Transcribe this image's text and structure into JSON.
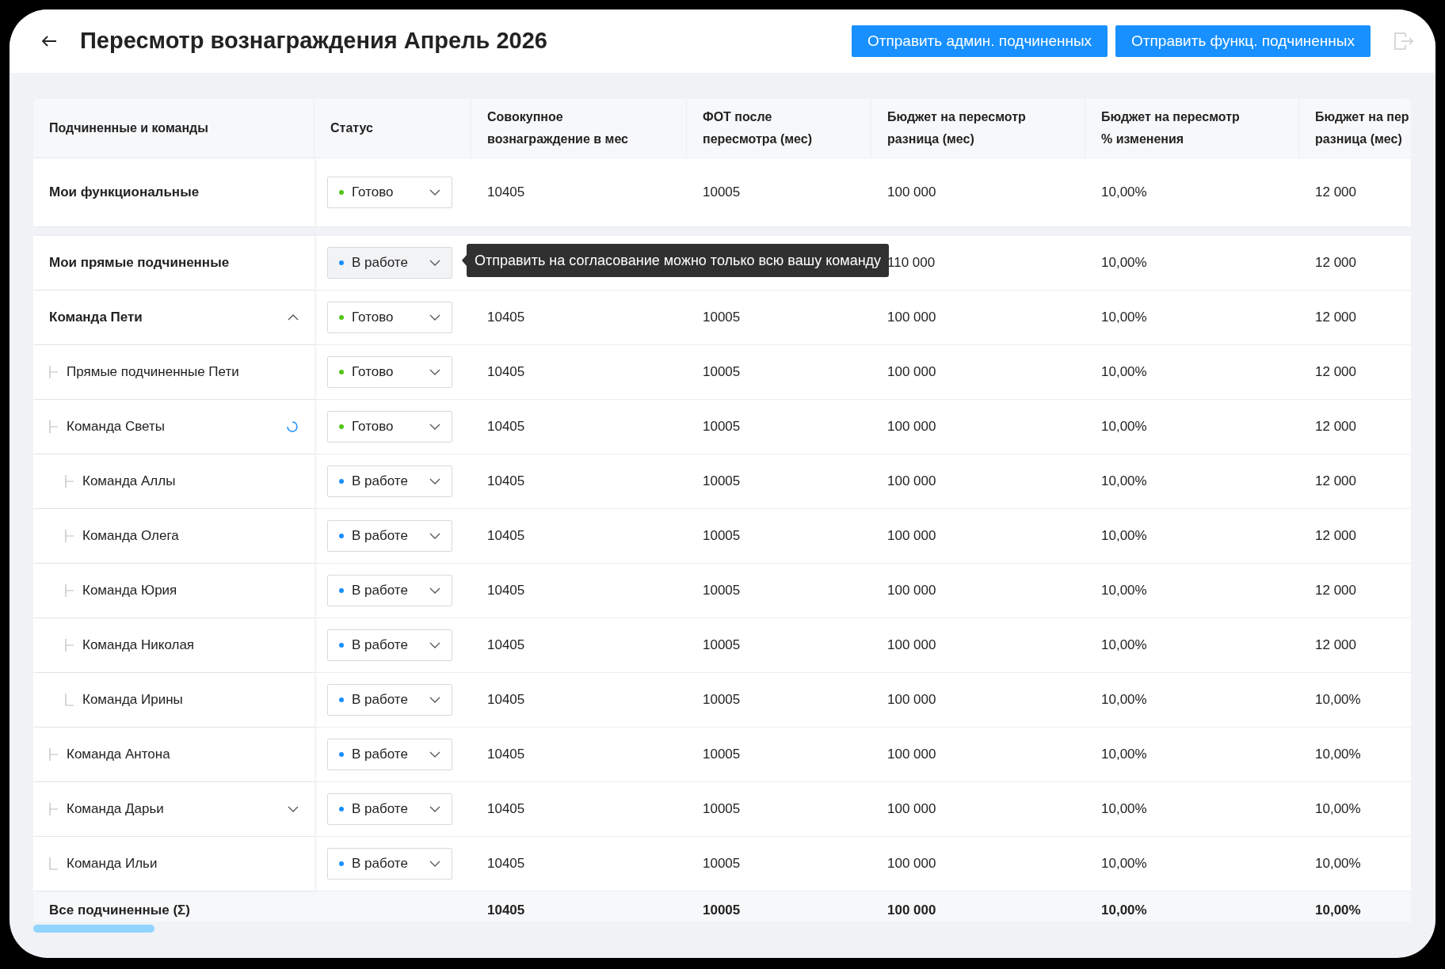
{
  "header": {
    "title": "Пересмотр вознаграждения Апрель 2026",
    "buttons": [
      "Отправить админ. подчиненных",
      "Отправить функц. подчиненных"
    ]
  },
  "table": {
    "columns": [
      {
        "lines": [
          "Подчиненные и команды"
        ]
      },
      {
        "lines": [
          "Статус"
        ]
      },
      {
        "lines": [
          "Совокупное",
          "вознаграждение в мес"
        ]
      },
      {
        "lines": [
          "ФОТ после",
          "пересмотра (мес)"
        ]
      },
      {
        "lines": [
          "Бюджет на пересмотр",
          "разница (мес)"
        ]
      },
      {
        "lines": [
          "Бюджет на пересмотр",
          "% изменения"
        ]
      },
      {
        "lines": [
          "Бюджет на пер",
          "разница (мес)"
        ]
      }
    ],
    "groups": [
      {
        "rows": [
          {
            "name": "Мои функциональные",
            "bold": true,
            "status": {
              "label": "Готово",
              "kind": "done",
              "disabled": false
            },
            "cells": [
              "10405",
              "10005",
              "100 000",
              "10,00%",
              "12 000"
            ]
          }
        ]
      },
      {
        "rows": [
          {
            "name": "Мои прямые подчиненные",
            "bold": true,
            "status": {
              "label": "В работе",
              "kind": "in_progress",
              "disabled": true
            },
            "tooltip": "Отправить на согласование можно только всю вашу команду",
            "cells": [
              null,
              null,
              "110 000",
              "10,00%",
              "12 000"
            ]
          },
          {
            "name": "Команда Пети",
            "bold": true,
            "expanded": true,
            "status": {
              "label": "Готово",
              "kind": "done",
              "disabled": false
            },
            "cells": [
              "10405",
              "10005",
              "100 000",
              "10,00%",
              "12 000"
            ],
            "children": [
              {
                "name": "Прямые подчиненные Пети",
                "status": {
                  "label": "Готово",
                  "kind": "done",
                  "disabled": false
                },
                "cells": [
                  "10405",
                  "10005",
                  "100 000",
                  "10,00%",
                  "12 000"
                ]
              },
              {
                "name": "Команда Светы",
                "loading": true,
                "status": {
                  "label": "Готово",
                  "kind": "done",
                  "disabled": false
                },
                "cells": [
                  "10405",
                  "10005",
                  "100 000",
                  "10,00%",
                  "12 000"
                ],
                "children": [
                  {
                    "name": "Команда Аллы",
                    "status": {
                      "label": "В работе",
                      "kind": "in_progress",
                      "disabled": false
                    },
                    "cells": [
                      "10405",
                      "10005",
                      "100 000",
                      "10,00%",
                      "12 000"
                    ]
                  },
                  {
                    "name": "Команда Олега",
                    "status": {
                      "label": "В работе",
                      "kind": "in_progress",
                      "disabled": false
                    },
                    "cells": [
                      "10405",
                      "10005",
                      "100 000",
                      "10,00%",
                      "12 000"
                    ]
                  },
                  {
                    "name": "Команда Юрия",
                    "status": {
                      "label": "В работе",
                      "kind": "in_progress",
                      "disabled": false
                    },
                    "cells": [
                      "10405",
                      "10005",
                      "100 000",
                      "10,00%",
                      "12 000"
                    ]
                  },
                  {
                    "name": "Команда Николая",
                    "status": {
                      "label": "В работе",
                      "kind": "in_progress",
                      "disabled": false
                    },
                    "cells": [
                      "10405",
                      "10005",
                      "100 000",
                      "10,00%",
                      "12 000"
                    ]
                  },
                  {
                    "name": "Команда Ирины",
                    "status": {
                      "label": "В работе",
                      "kind": "in_progress",
                      "disabled": false
                    },
                    "cells": [
                      "10405",
                      "10005",
                      "100 000",
                      "10,00%",
                      "10,00%"
                    ]
                  }
                ]
              },
              {
                "name": "Команда Антона",
                "status": {
                  "label": "В работе",
                  "kind": "in_progress",
                  "disabled": false
                },
                "cells": [
                  "10405",
                  "10005",
                  "100 000",
                  "10,00%",
                  "10,00%"
                ]
              },
              {
                "name": "Команда Дарьи",
                "expanded": false,
                "status": {
                  "label": "В работе",
                  "kind": "in_progress",
                  "disabled": false
                },
                "cells": [
                  "10405",
                  "10005",
                  "100 000",
                  "10,00%",
                  "10,00%"
                ]
              },
              {
                "name": "Команда Ильи",
                "status": {
                  "label": "В работе",
                  "kind": "in_progress",
                  "disabled": false
                },
                "cells": [
                  "10405",
                  "10005",
                  "100 000",
                  "10,00%",
                  "10,00%"
                ]
              }
            ]
          }
        ]
      }
    ],
    "total": {
      "name": "Все подчиненные (Σ)",
      "cells": [
        "10405",
        "10005",
        "100 000",
        "10,00%",
        "10,00%"
      ]
    }
  }
}
